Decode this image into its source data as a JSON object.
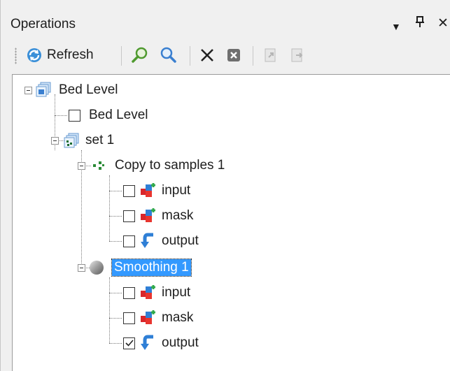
{
  "panel": {
    "title": "Operations",
    "controls": {
      "menu": "▼",
      "pin": "ᵖ",
      "close": "✕"
    }
  },
  "toolbar": {
    "refresh_label": "Refresh",
    "buttons": [
      "refresh-icon",
      "find-icon",
      "search-icon",
      "delete-icon",
      "remove-icon",
      "import-icon",
      "export-icon"
    ]
  },
  "tree": {
    "root": {
      "label": "Bed Level"
    },
    "bed_level_item": {
      "label": "Bed Level",
      "checked": false
    },
    "set": {
      "label": "set 1"
    },
    "copy_op": {
      "label": "Copy to samples 1",
      "items": [
        {
          "label": "input",
          "checked": false
        },
        {
          "label": "mask",
          "checked": false
        },
        {
          "label": "output",
          "checked": false
        }
      ]
    },
    "smooth_op": {
      "label": "Smoothing 1",
      "selected": true,
      "items": [
        {
          "label": "input",
          "checked": false
        },
        {
          "label": "mask",
          "checked": false
        },
        {
          "label": "output",
          "checked": true
        }
      ]
    }
  },
  "colors": {
    "selection": "#3399ff",
    "panel_bg": "#f0f0f0",
    "tree_bg": "#ffffff"
  }
}
